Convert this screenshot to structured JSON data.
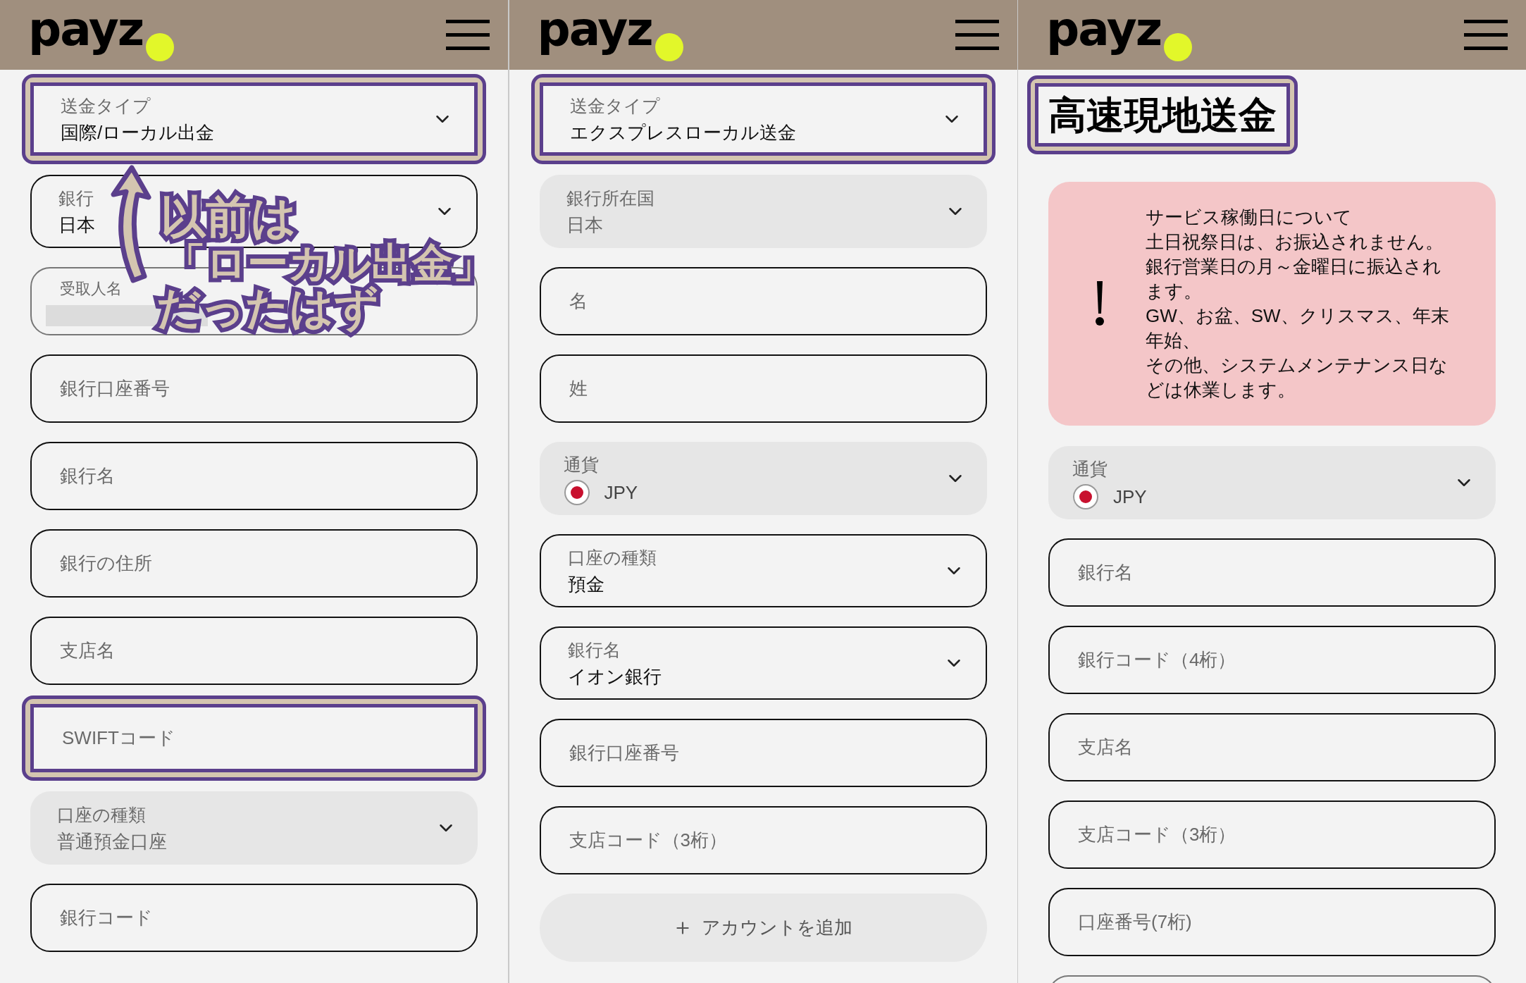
{
  "panels": [
    {
      "logo": "payz",
      "fields": [
        {
          "kind": "select",
          "label": "送金タイプ",
          "value": "国際/ローカル出金",
          "disabled": false,
          "highlighted": true
        },
        {
          "kind": "select",
          "label": "銀行",
          "value": "日本",
          "disabled": false,
          "highlighted": false
        },
        {
          "kind": "redacted",
          "label": "受取人名",
          "disabled": false,
          "highlighted": false
        },
        {
          "kind": "input",
          "placeholder": "銀行口座番号",
          "disabled": false,
          "highlighted": false
        },
        {
          "kind": "input",
          "placeholder": "銀行名",
          "disabled": false,
          "highlighted": false
        },
        {
          "kind": "input",
          "placeholder": "銀行の住所",
          "disabled": false,
          "highlighted": false
        },
        {
          "kind": "input",
          "placeholder": "支店名",
          "disabled": false,
          "highlighted": false
        },
        {
          "kind": "input",
          "placeholder": "SWIFTコード",
          "disabled": false,
          "highlighted": true
        },
        {
          "kind": "select",
          "label": "口座の種類",
          "value": "普通預金口座",
          "disabled": true,
          "highlighted": false
        },
        {
          "kind": "input",
          "placeholder": "銀行コード",
          "disabled": false,
          "highlighted": false
        }
      ],
      "annotation": {
        "lines": [
          "以前は",
          "「ローカル出金」",
          "だったはず"
        ]
      }
    },
    {
      "logo": "payz",
      "fields": [
        {
          "kind": "select",
          "label": "送金タイプ",
          "value": "エクスプレスローカル送金",
          "disabled": false,
          "highlighted": true
        },
        {
          "kind": "select",
          "label": "銀行所在国",
          "value": "日本",
          "disabled": true,
          "highlighted": false
        },
        {
          "kind": "input",
          "placeholder": "名",
          "disabled": false,
          "highlighted": false
        },
        {
          "kind": "input",
          "placeholder": "姓",
          "disabled": false,
          "highlighted": false
        },
        {
          "kind": "currency",
          "label": "通貨",
          "value": "JPY",
          "disabled": true,
          "highlighted": false
        },
        {
          "kind": "select",
          "label": "口座の種類",
          "value": "預金",
          "disabled": false,
          "highlighted": false
        },
        {
          "kind": "select",
          "label": "銀行名",
          "value": "イオン銀行",
          "disabled": false,
          "highlighted": false
        },
        {
          "kind": "input",
          "placeholder": "銀行口座番号",
          "disabled": false,
          "highlighted": false
        },
        {
          "kind": "input",
          "placeholder": "支店コード（3桁）",
          "disabled": false,
          "highlighted": false
        },
        {
          "kind": "button",
          "label": "アカウントを追加",
          "disabled": false,
          "highlighted": false
        }
      ]
    },
    {
      "logo": "payz",
      "title": {
        "text": "高速現地送金",
        "highlighted": true
      },
      "alert": {
        "lines": [
          "サービス稼働日について",
          "土日祝祭日は、お振込されません。",
          "銀行営業日の月～金曜日に振込されます。",
          "GW、お盆、SW、クリスマス、年末年始、",
          "その他、システムメンテナンス日などは休業します。"
        ]
      },
      "fields": [
        {
          "kind": "currency",
          "label": "通貨",
          "value": "JPY",
          "disabled": true,
          "highlighted": false
        },
        {
          "kind": "input",
          "placeholder": "銀行名",
          "disabled": false,
          "highlighted": false
        },
        {
          "kind": "input",
          "placeholder": "銀行コード（4桁）",
          "disabled": false,
          "highlighted": false
        },
        {
          "kind": "input",
          "placeholder": "支店名",
          "disabled": false,
          "highlighted": false
        },
        {
          "kind": "input",
          "placeholder": "支店コード（3桁）",
          "disabled": false,
          "highlighted": false
        },
        {
          "kind": "input",
          "placeholder": "口座番号(7桁)",
          "disabled": false,
          "highlighted": false
        },
        {
          "kind": "input",
          "disabled": false,
          "highlighted": false
        }
      ]
    }
  ]
}
